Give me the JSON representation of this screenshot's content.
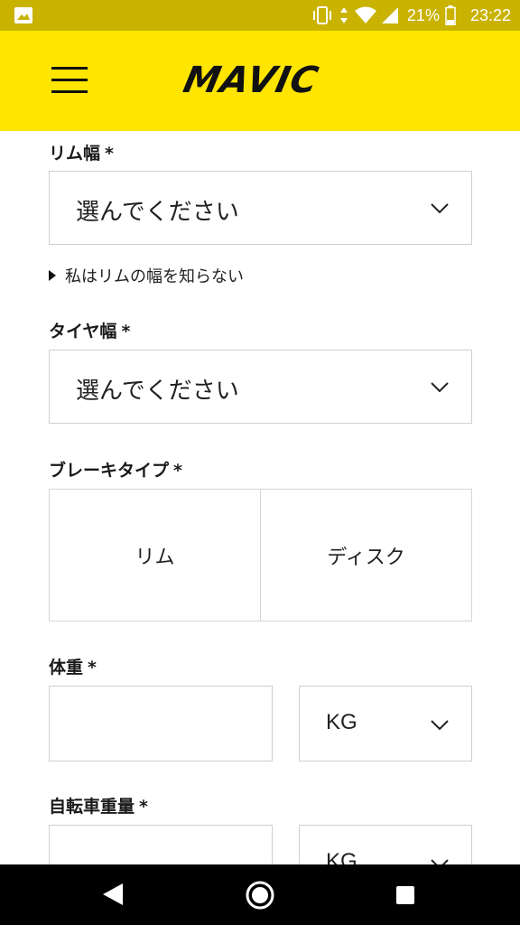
{
  "status_bar": {
    "battery_pct": "21%",
    "time": "23:22",
    "icons": [
      "gallery-icon",
      "vibrate-icon",
      "data-arrows-icon",
      "wifi-icon",
      "signal-icon",
      "battery-icon"
    ]
  },
  "header": {
    "logo": "MAVIC",
    "menu_icon": "hamburger-menu-icon"
  },
  "form": {
    "rim_width": {
      "label": "リム幅",
      "required": "*",
      "value": "選んでください"
    },
    "rim_hint": "私はリムの幅を知らない",
    "tire_width": {
      "label": "タイヤ幅",
      "required": "*",
      "value": "選んでください"
    },
    "brake_type": {
      "label": "ブレーキタイプ",
      "required": "*",
      "options": [
        "リム",
        "ディスク"
      ]
    },
    "body_weight": {
      "label": "体重",
      "required": "*",
      "value": "",
      "unit": "KG"
    },
    "bike_weight": {
      "label": "自転車重量",
      "required": "*",
      "value": "",
      "unit": "KG"
    }
  },
  "colors": {
    "status_bar": "#c9b200",
    "header": "#ffe500",
    "nav_bar": "#000000",
    "border": "#cfcfcf"
  }
}
